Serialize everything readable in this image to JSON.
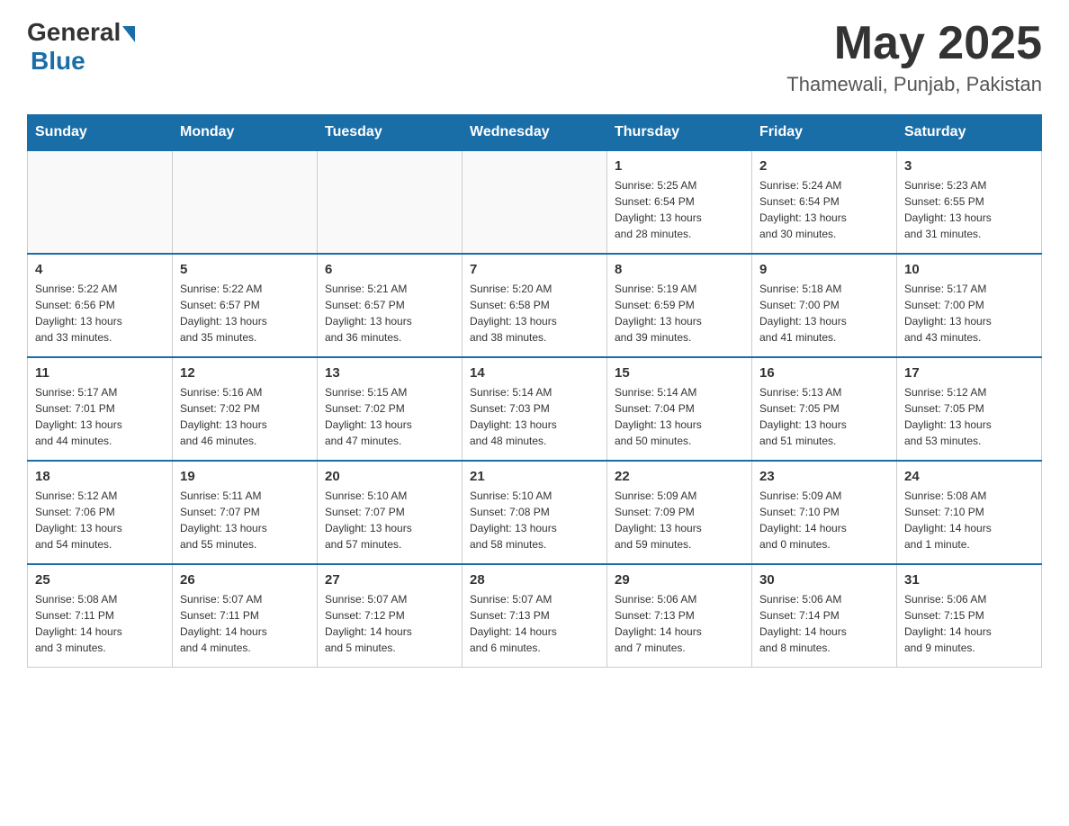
{
  "header": {
    "logo_general": "General",
    "logo_blue": "Blue",
    "month_year": "May 2025",
    "location": "Thamewali, Punjab, Pakistan"
  },
  "weekdays": [
    "Sunday",
    "Monday",
    "Tuesday",
    "Wednesday",
    "Thursday",
    "Friday",
    "Saturday"
  ],
  "weeks": [
    {
      "days": [
        {
          "num": "",
          "info": ""
        },
        {
          "num": "",
          "info": ""
        },
        {
          "num": "",
          "info": ""
        },
        {
          "num": "",
          "info": ""
        },
        {
          "num": "1",
          "info": "Sunrise: 5:25 AM\nSunset: 6:54 PM\nDaylight: 13 hours\nand 28 minutes."
        },
        {
          "num": "2",
          "info": "Sunrise: 5:24 AM\nSunset: 6:54 PM\nDaylight: 13 hours\nand 30 minutes."
        },
        {
          "num": "3",
          "info": "Sunrise: 5:23 AM\nSunset: 6:55 PM\nDaylight: 13 hours\nand 31 minutes."
        }
      ]
    },
    {
      "days": [
        {
          "num": "4",
          "info": "Sunrise: 5:22 AM\nSunset: 6:56 PM\nDaylight: 13 hours\nand 33 minutes."
        },
        {
          "num": "5",
          "info": "Sunrise: 5:22 AM\nSunset: 6:57 PM\nDaylight: 13 hours\nand 35 minutes."
        },
        {
          "num": "6",
          "info": "Sunrise: 5:21 AM\nSunset: 6:57 PM\nDaylight: 13 hours\nand 36 minutes."
        },
        {
          "num": "7",
          "info": "Sunrise: 5:20 AM\nSunset: 6:58 PM\nDaylight: 13 hours\nand 38 minutes."
        },
        {
          "num": "8",
          "info": "Sunrise: 5:19 AM\nSunset: 6:59 PM\nDaylight: 13 hours\nand 39 minutes."
        },
        {
          "num": "9",
          "info": "Sunrise: 5:18 AM\nSunset: 7:00 PM\nDaylight: 13 hours\nand 41 minutes."
        },
        {
          "num": "10",
          "info": "Sunrise: 5:17 AM\nSunset: 7:00 PM\nDaylight: 13 hours\nand 43 minutes."
        }
      ]
    },
    {
      "days": [
        {
          "num": "11",
          "info": "Sunrise: 5:17 AM\nSunset: 7:01 PM\nDaylight: 13 hours\nand 44 minutes."
        },
        {
          "num": "12",
          "info": "Sunrise: 5:16 AM\nSunset: 7:02 PM\nDaylight: 13 hours\nand 46 minutes."
        },
        {
          "num": "13",
          "info": "Sunrise: 5:15 AM\nSunset: 7:02 PM\nDaylight: 13 hours\nand 47 minutes."
        },
        {
          "num": "14",
          "info": "Sunrise: 5:14 AM\nSunset: 7:03 PM\nDaylight: 13 hours\nand 48 minutes."
        },
        {
          "num": "15",
          "info": "Sunrise: 5:14 AM\nSunset: 7:04 PM\nDaylight: 13 hours\nand 50 minutes."
        },
        {
          "num": "16",
          "info": "Sunrise: 5:13 AM\nSunset: 7:05 PM\nDaylight: 13 hours\nand 51 minutes."
        },
        {
          "num": "17",
          "info": "Sunrise: 5:12 AM\nSunset: 7:05 PM\nDaylight: 13 hours\nand 53 minutes."
        }
      ]
    },
    {
      "days": [
        {
          "num": "18",
          "info": "Sunrise: 5:12 AM\nSunset: 7:06 PM\nDaylight: 13 hours\nand 54 minutes."
        },
        {
          "num": "19",
          "info": "Sunrise: 5:11 AM\nSunset: 7:07 PM\nDaylight: 13 hours\nand 55 minutes."
        },
        {
          "num": "20",
          "info": "Sunrise: 5:10 AM\nSunset: 7:07 PM\nDaylight: 13 hours\nand 57 minutes."
        },
        {
          "num": "21",
          "info": "Sunrise: 5:10 AM\nSunset: 7:08 PM\nDaylight: 13 hours\nand 58 minutes."
        },
        {
          "num": "22",
          "info": "Sunrise: 5:09 AM\nSunset: 7:09 PM\nDaylight: 13 hours\nand 59 minutes."
        },
        {
          "num": "23",
          "info": "Sunrise: 5:09 AM\nSunset: 7:10 PM\nDaylight: 14 hours\nand 0 minutes."
        },
        {
          "num": "24",
          "info": "Sunrise: 5:08 AM\nSunset: 7:10 PM\nDaylight: 14 hours\nand 1 minute."
        }
      ]
    },
    {
      "days": [
        {
          "num": "25",
          "info": "Sunrise: 5:08 AM\nSunset: 7:11 PM\nDaylight: 14 hours\nand 3 minutes."
        },
        {
          "num": "26",
          "info": "Sunrise: 5:07 AM\nSunset: 7:11 PM\nDaylight: 14 hours\nand 4 minutes."
        },
        {
          "num": "27",
          "info": "Sunrise: 5:07 AM\nSunset: 7:12 PM\nDaylight: 14 hours\nand 5 minutes."
        },
        {
          "num": "28",
          "info": "Sunrise: 5:07 AM\nSunset: 7:13 PM\nDaylight: 14 hours\nand 6 minutes."
        },
        {
          "num": "29",
          "info": "Sunrise: 5:06 AM\nSunset: 7:13 PM\nDaylight: 14 hours\nand 7 minutes."
        },
        {
          "num": "30",
          "info": "Sunrise: 5:06 AM\nSunset: 7:14 PM\nDaylight: 14 hours\nand 8 minutes."
        },
        {
          "num": "31",
          "info": "Sunrise: 5:06 AM\nSunset: 7:15 PM\nDaylight: 14 hours\nand 9 minutes."
        }
      ]
    }
  ]
}
